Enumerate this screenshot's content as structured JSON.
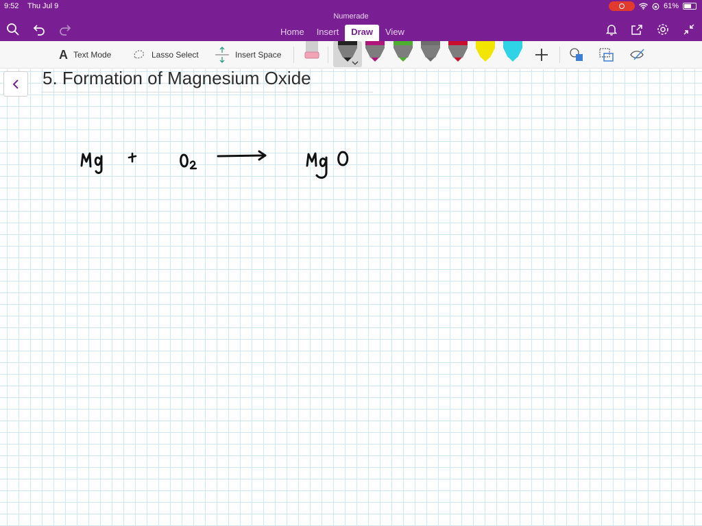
{
  "status": {
    "time": "9:52",
    "date": "Thu Jul 9",
    "battery": "61%"
  },
  "app": {
    "name": "Numerade"
  },
  "tabs": [
    {
      "label": "Home"
    },
    {
      "label": "Insert"
    },
    {
      "label": "Draw"
    },
    {
      "label": "View"
    }
  ],
  "active_tab": "Draw",
  "toolbar": {
    "text_mode": "Text Mode",
    "lasso_select": "Lasso Select",
    "insert_space": "Insert Space"
  },
  "pen_colors": [
    "#222222",
    "#b0157a",
    "#4caf2f",
    "#6e6e6e",
    "#c8102e",
    "#f2e500",
    "#2fd3e6"
  ],
  "page": {
    "title": "5. Formation of Magnesium Oxide"
  },
  "ink": [
    "Mg",
    "+",
    "O2",
    "→",
    "MgO"
  ]
}
